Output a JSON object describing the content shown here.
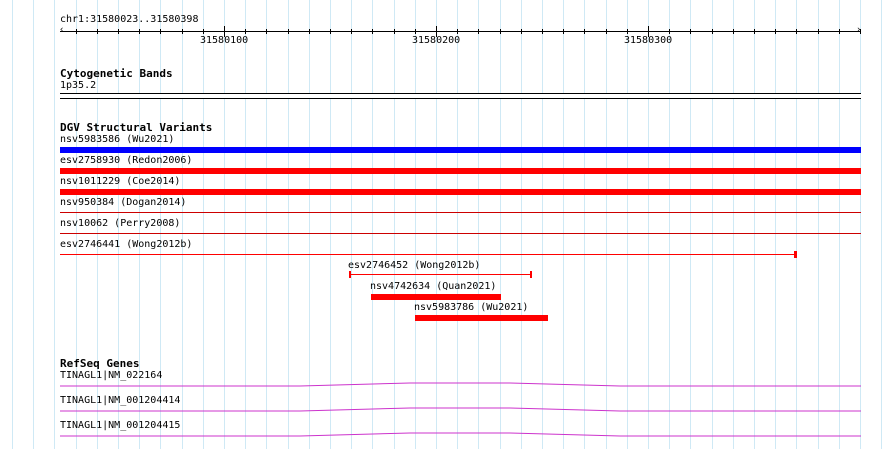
{
  "ruler": {
    "range_label": "chr1:31580023..31580398",
    "tick_labels": [
      "31580100",
      "31580200",
      "31580300"
    ]
  },
  "cytoband": {
    "title": "Cytogenetic Bands",
    "band_label": "1p35.2"
  },
  "dgv": {
    "title": "DGV Structural Variants",
    "items": [
      {
        "label": "nsv5983586 (Wu2021)",
        "color": "#0000ff"
      },
      {
        "label": "esv2758930 (Redon2006)",
        "color": "#ff0000"
      },
      {
        "label": "nsv1011229 (Coe2014)",
        "color": "#ff0000"
      },
      {
        "label": "nsv950384 (Dogan2014)",
        "color": "#cc0000"
      },
      {
        "label": "nsv10062 (Perry2008)",
        "color": "#cc0000"
      },
      {
        "label": "esv2746441 (Wong2012b)",
        "color": "#ff0000"
      },
      {
        "label": "esv2746452 (Wong2012b)",
        "color": "#ff0000"
      },
      {
        "label": "nsv4742634 (Quan2021)",
        "color": "#ff0000"
      },
      {
        "label": "nsv5983786 (Wu2021)",
        "color": "#ff0000"
      }
    ]
  },
  "refseq": {
    "title": "RefSeq Genes",
    "items": [
      {
        "label": "TINAGL1|NM_022164",
        "color": "#cc33cc"
      },
      {
        "label": "TINAGL1|NM_001204414",
        "color": "#cc33cc"
      },
      {
        "label": "TINAGL1|NM_001204415",
        "color": "#cc33cc"
      }
    ]
  }
}
